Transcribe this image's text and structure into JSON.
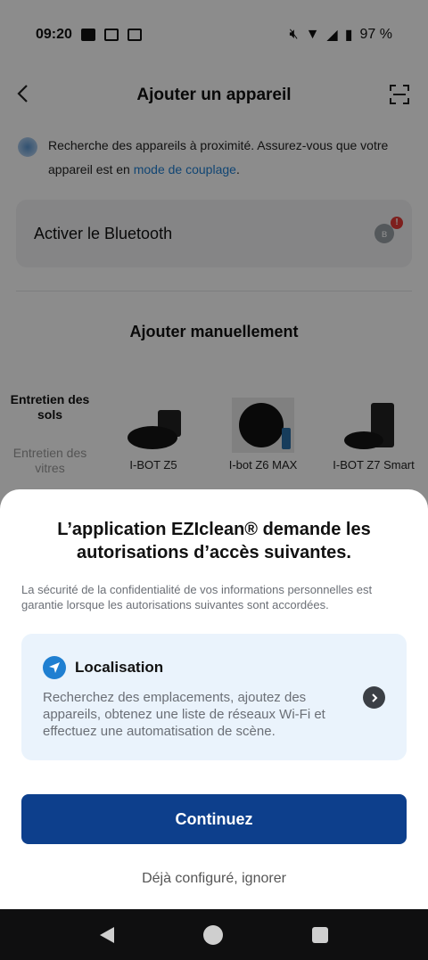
{
  "status_bar": {
    "time": "09:20",
    "battery": "97 %",
    "icons": [
      "fnac-icon",
      "news-icon",
      "calendar-icon",
      "mute-icon",
      "wifi-icon",
      "signal-icon",
      "battery-icon"
    ]
  },
  "header": {
    "title": "Ajouter un appareil"
  },
  "scan": {
    "text": "Recherche des appareils à proximité. Assurez-vous que votre appareil est en ",
    "link": "mode de couplage",
    "suffix": "."
  },
  "bluetooth": {
    "label": "Activer le Bluetooth",
    "badge": "!"
  },
  "manual": {
    "title": "Ajouter manuellement",
    "categories": [
      {
        "label": "Entretien des sols"
      },
      {
        "label": "Entretien des vitres"
      }
    ],
    "products": [
      {
        "name": "I-BOT Z5"
      },
      {
        "name": "I-bot Z6 MAX"
      },
      {
        "name": "I-BOT Z7 Smart"
      }
    ]
  },
  "sheet": {
    "title": "L’application EZIclean® demande les autorisations d’accès suivantes.",
    "description": "La sécurité de la confidentialité de vos informations personnelles est garantie lorsque les autorisations suivantes sont accordées.",
    "permission": {
      "title": "Localisation",
      "description": "Recherchez des emplacements, ajoutez des appareils, obtenez une liste de réseaux Wi-Fi et effectuez une automatisation de scène."
    },
    "continue_label": "Continuez",
    "skip_label": "Déjà configuré, ignorer"
  },
  "colors": {
    "primary": "#0d3f8c",
    "link": "#1f7fd1",
    "card_bg": "#eaf3fc"
  }
}
